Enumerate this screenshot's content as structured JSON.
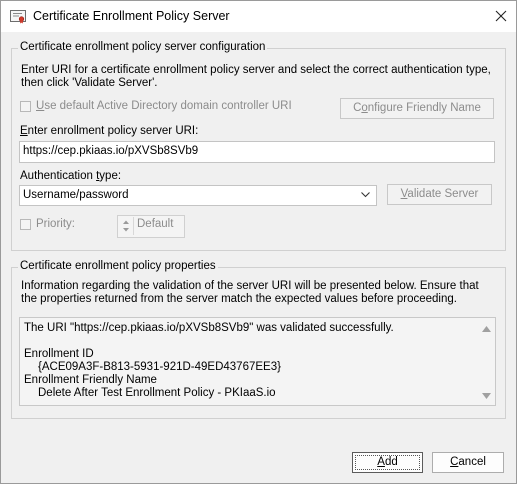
{
  "window": {
    "title": "Certificate Enrollment Policy Server"
  },
  "config_group": {
    "legend": "Certificate enrollment policy server configuration",
    "description": "Enter URI for a certificate enrollment policy server and select the correct authentication type, then click 'Validate Server'.",
    "use_default_ad": {
      "label_prefix": "",
      "label_accel": "U",
      "label_rest": "se default Active Directory domain controller URI",
      "checked": false
    },
    "configure_friendly_name": {
      "prefix": "C",
      "accel": "o",
      "rest": "nfigure Friendly Name"
    },
    "uri_label": {
      "accel": "E",
      "rest": "nter enrollment policy server URI:"
    },
    "uri_value": "https://cep.pkiaas.io/pXVSb8SVb9",
    "auth_label": {
      "prefix": "Authentication ",
      "accel": "t",
      "rest": "ype:"
    },
    "auth_selected": "Username/password",
    "validate_server": {
      "accel": "V",
      "rest": "alidate Server"
    },
    "priority": {
      "label": "Priority:",
      "checked": false,
      "spin_value": "Default"
    }
  },
  "properties_group": {
    "legend": "Certificate enrollment policy properties",
    "description": "Information regarding the validation of the server URI will be presented below. Ensure that the properties returned from the server match the expected values before proceeding.",
    "results": {
      "validated_message": "The URI \"https://cep.pkiaas.io/pXVSb8SVb9\" was validated successfully.",
      "enrollment_id_label": "Enrollment ID",
      "enrollment_id_value": "{ACE09A3F-B813-5931-921D-49ED43767EE3}",
      "friendly_name_label": "Enrollment Friendly Name",
      "friendly_name_value": "Delete After Test Enrollment Policy - PKIaaS.io"
    }
  },
  "buttons": {
    "add": {
      "accel": "A",
      "rest": "dd"
    },
    "cancel": {
      "accel": "C",
      "rest": "ancel"
    }
  },
  "icons": {
    "title": "certificate-icon",
    "close": "close-icon",
    "combo": "chevron-down-icon",
    "spin": "spin-arrows-icon"
  },
  "colors": {
    "disabled_text": "#8c8c8c",
    "window_bg": "#f0f0f0"
  }
}
